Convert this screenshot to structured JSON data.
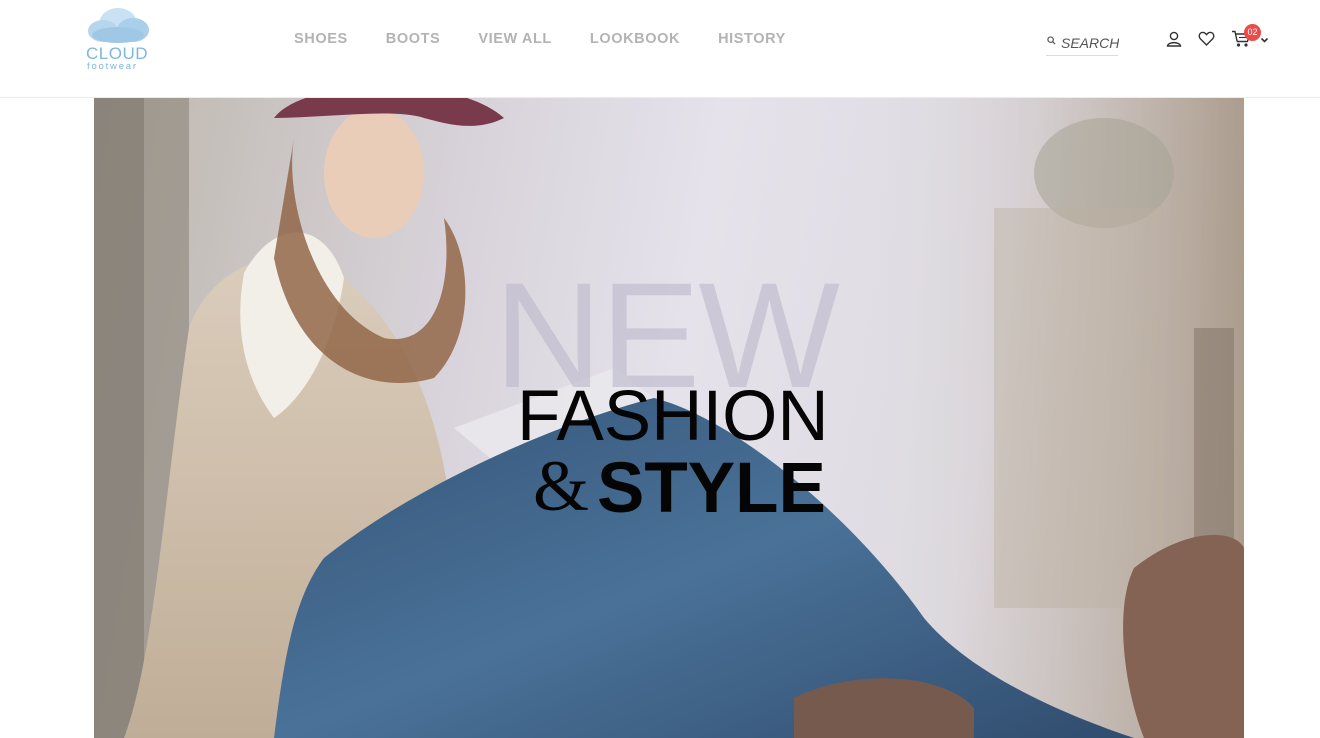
{
  "brand": {
    "name": "CLOUD",
    "tagline": "footwear",
    "color": "#7fb6dc"
  },
  "nav": {
    "items": [
      {
        "label": "SHOES"
      },
      {
        "label": "BOOTS"
      },
      {
        "label": "VIEW ALL"
      },
      {
        "label": "LOOKBOOK"
      },
      {
        "label": "HISTORY"
      }
    ]
  },
  "search": {
    "placeholder": "SEARCH",
    "icon": "search-icon"
  },
  "header_icons": {
    "account": "user-icon",
    "wishlist": "heart-icon",
    "cart": "cart-icon"
  },
  "cart": {
    "count": "02",
    "badge_color": "#ee4a4a"
  },
  "hero": {
    "word_new": "NEW",
    "line1": "FASHION",
    "ampersand": "&",
    "line2": "STYLE"
  }
}
